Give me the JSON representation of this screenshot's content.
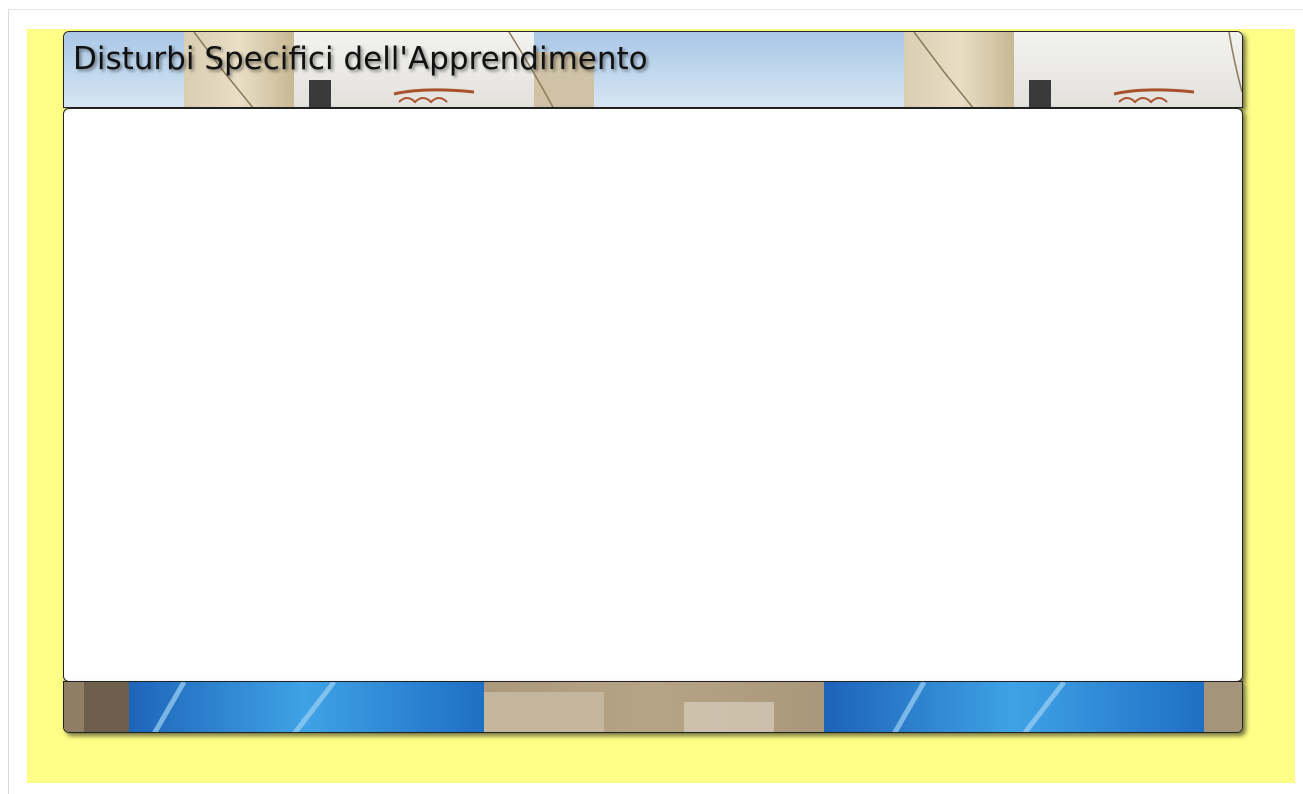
{
  "page": {
    "title": "Disturbi Specifici dell'Apprendimento",
    "background_color": "#ffff88",
    "content_color": "#ffffff"
  },
  "header": {
    "background": "photo-village-houses"
  },
  "footer": {
    "background": "photo-blue-doors-cobblestones"
  }
}
